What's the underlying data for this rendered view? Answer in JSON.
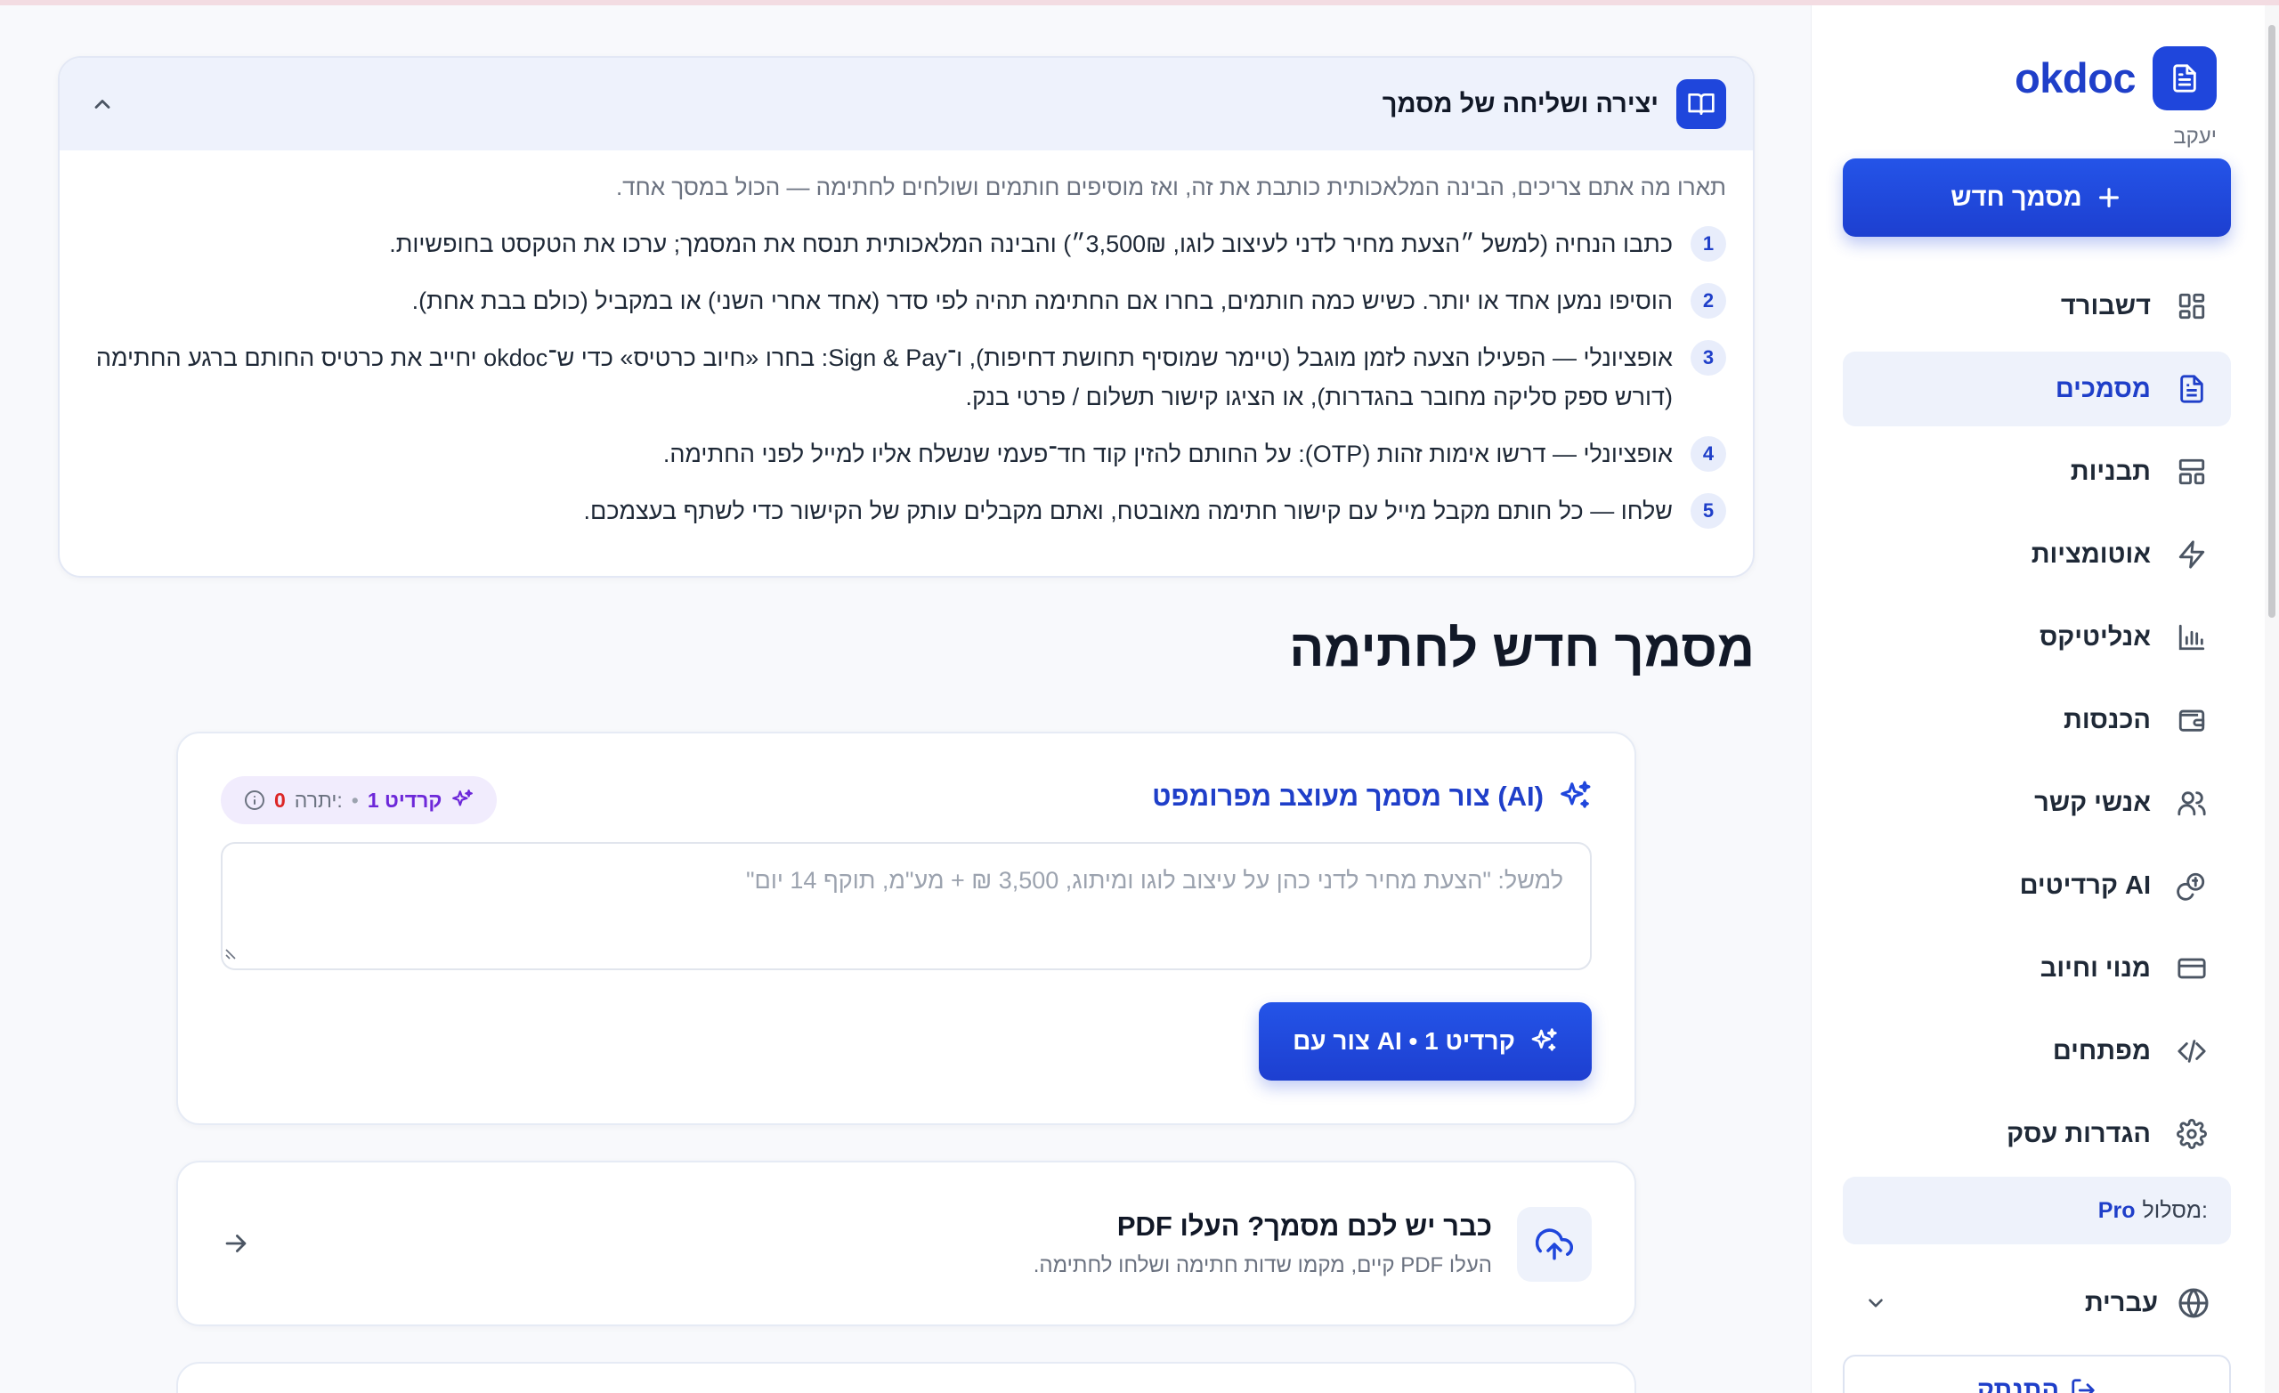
{
  "sidebar": {
    "brand": "okdoc",
    "user": "יעקב",
    "new_doc_label": "מסמך חדש",
    "items": [
      {
        "label": "דשבורד",
        "icon": "dashboard-icon"
      },
      {
        "label": "מסמכים",
        "icon": "document-icon",
        "active": true
      },
      {
        "label": "תבניות",
        "icon": "templates-icon"
      },
      {
        "label": "אוטומציות",
        "icon": "lightning-icon"
      },
      {
        "label": "אנליטיקס",
        "icon": "bar-chart-icon"
      },
      {
        "label": "הכנסות",
        "icon": "wallet-icon"
      },
      {
        "label": "אנשי קשר",
        "icon": "users-icon"
      },
      {
        "label": "קרדיטים AI",
        "icon": "coins-icon"
      },
      {
        "label": "מנוי וחיוב",
        "icon": "credit-card-icon"
      },
      {
        "label": "מפתחים",
        "icon": "code-icon"
      },
      {
        "label": "הגדרות עסק",
        "icon": "gear-icon"
      }
    ],
    "plan_label": "מסלול:",
    "plan_value": "Pro",
    "language": "עברית",
    "logout": "התנתק"
  },
  "guide": {
    "title": "יצירה ושליחה של מסמך",
    "intro": "תארו מה אתם צריכים, הבינה המלאכותית כותבת את זה, ואז מוסיפים חותמים ושולחים לחתימה — הכול במסך אחד.",
    "steps": [
      {
        "num": "1",
        "text": "כתבו הנחיה (למשל ״הצעת מחיר לדני לעיצוב לוגו, 3,500₪״) והבינה המלאכותית תנסח את המסמך; ערכו את הטקסט בחופשיות."
      },
      {
        "num": "2",
        "text": "הוסיפו נמען אחד או יותר. כשיש כמה חותמים, בחרו אם החתימה תהיה לפי סדר (אחד אחרי השני) או במקביל (כולם בבת אחת)."
      },
      {
        "num": "3",
        "text": "אופציונלי — הפעילו הצעה לזמן מוגבל (טיימר שמוסיף תחושת דחיפות), ו־Sign & Pay: בחרו «חיוב כרטיס» כדי ש־okdoc יחייב את כרטיס החותם ברגע החתימה (דורש ספק סליקה מחובר בהגדרות), או הציגו קישור תשלום / פרטי בנק."
      },
      {
        "num": "4",
        "text": "אופציונלי — דרשו אימות זהות (OTP): על החותם להזין קוד חד־פעמי שנשלח אליו למייל לפני החתימה."
      },
      {
        "num": "5",
        "text": "שלחו — כל חותם מקבל מייל עם קישור חתימה מאובטח, ואתם מקבלים עותק של הקישור כדי לשתף בעצמכם."
      }
    ]
  },
  "page_title": "מסמך חדש לחתימה",
  "ai_card": {
    "title": "צור מסמך מעוצב מפרומפט (AI)",
    "credit_cost": "1 קרדיט",
    "remaining_label": "יתרה:",
    "remaining_value": "0",
    "placeholder": "למשל: \"הצעת מחיר לדני כהן על עיצוב לוגו ומיתוג, 3,500 ₪ + מע\"מ, תוקף 14 יום\"",
    "generate_label": "צור עם AI • 1 קרדיט"
  },
  "upload_card": {
    "title": "כבר יש לכם מסמך? העלו PDF",
    "subtitle": "העלו PDF קיים, מקמו שדות חתימה ושלחו לחתימה."
  },
  "colors": {
    "accent": "#1f46dc",
    "accent_text": "#1f3fc9",
    "active_bg": "#eef2fb",
    "credit_purple": "#6d28d9",
    "remaining_red": "#dc2626"
  }
}
